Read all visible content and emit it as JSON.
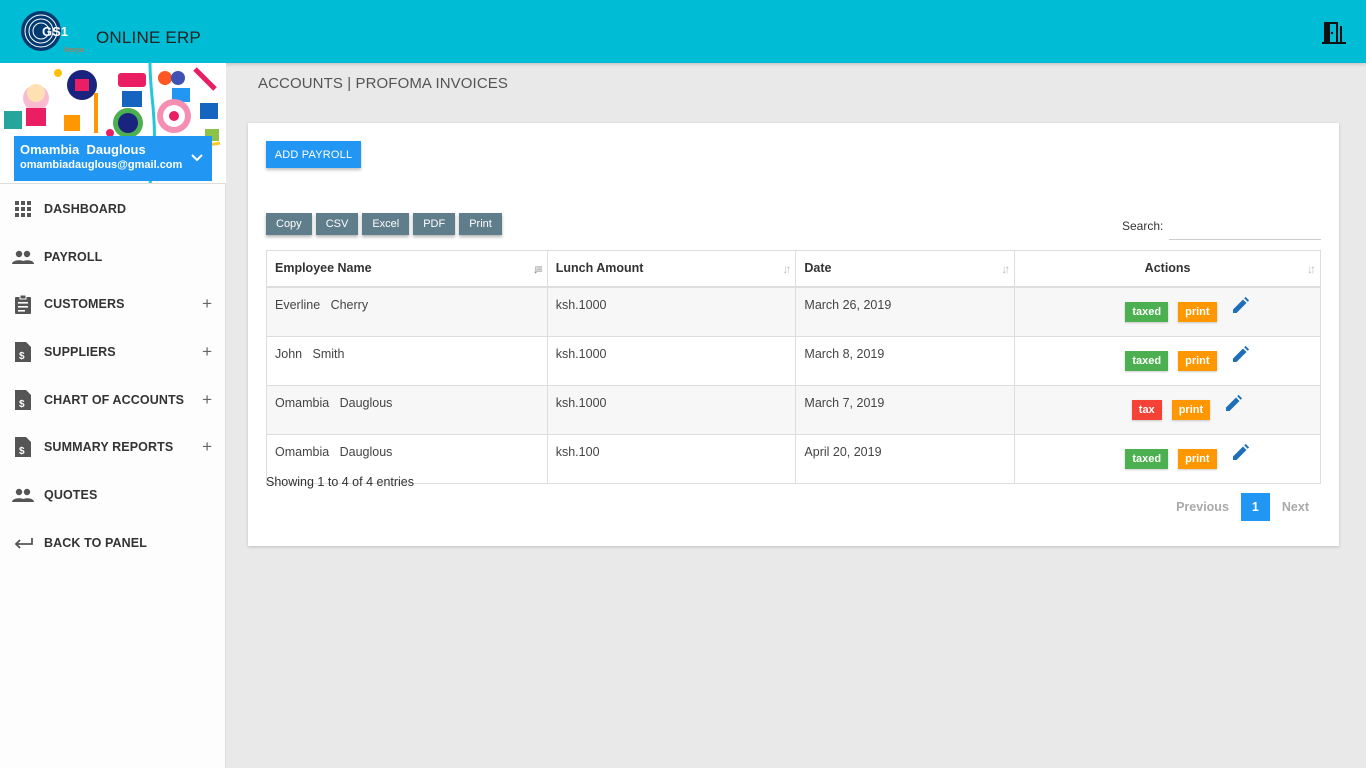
{
  "app": {
    "logo_text": "GS1",
    "logo_sub": "Kenya",
    "title": "ONLINE ERP"
  },
  "user": {
    "name": "Omambia  Dauglous",
    "email": "omambiadauglous@gmail.com"
  },
  "nav": [
    {
      "label": "DASHBOARD",
      "icon": "grid-icon",
      "expandable": false
    },
    {
      "label": "PAYROLL",
      "icon": "people-icon",
      "expandable": false
    },
    {
      "label": "CUSTOMERS",
      "icon": "clipboard-icon",
      "expandable": true
    },
    {
      "label": "SUPPLIERS",
      "icon": "invoice-icon",
      "expandable": true
    },
    {
      "label": "CHART OF ACCOUNTS",
      "icon": "invoice-icon",
      "expandable": true
    },
    {
      "label": "SUMMARY REPORTS",
      "icon": "invoice-icon",
      "expandable": true
    },
    {
      "label": "QUOTES",
      "icon": "people-icon",
      "expandable": false
    },
    {
      "label": "BACK TO PANEL",
      "icon": "back-arrow-icon",
      "expandable": false
    }
  ],
  "page": {
    "title": "ACCOUNTS | PROFOMA INVOICES",
    "add_button": "ADD PAYROLL",
    "export_buttons": [
      "Copy",
      "CSV",
      "Excel",
      "PDF",
      "Print"
    ],
    "search_label": "Search:",
    "search_value": ""
  },
  "table": {
    "columns": [
      "Employee Name",
      "Lunch Amount",
      "Date",
      "Actions"
    ],
    "rows": [
      {
        "name": "Everline   Cherry",
        "amount": "ksh.1000",
        "date": "March 26, 2019",
        "status": "taxed",
        "status_color": "#4caf50",
        "print": "print"
      },
      {
        "name": "John   Smith",
        "amount": "ksh.1000",
        "date": "March 8, 2019",
        "status": "taxed",
        "status_color": "#4caf50",
        "print": "print"
      },
      {
        "name": "Omambia   Dauglous",
        "amount": "ksh.1000",
        "date": "March 7, 2019",
        "status": "tax",
        "status_color": "#f44336",
        "print": "print"
      },
      {
        "name": "Omambia   Dauglous",
        "amount": "ksh.100",
        "date": "April 20, 2019",
        "status": "taxed",
        "status_color": "#4caf50",
        "print": "print"
      }
    ]
  },
  "footer": {
    "info": "Showing 1 to 4 of 4 entries",
    "previous": "Previous",
    "current_page": "1",
    "next": "Next"
  },
  "colors": {
    "topbar": "#00bcd4",
    "primary": "#2196f3",
    "export_button": "#607d8b",
    "taxed": "#4caf50",
    "tax": "#f44336",
    "print": "#ff9800"
  }
}
